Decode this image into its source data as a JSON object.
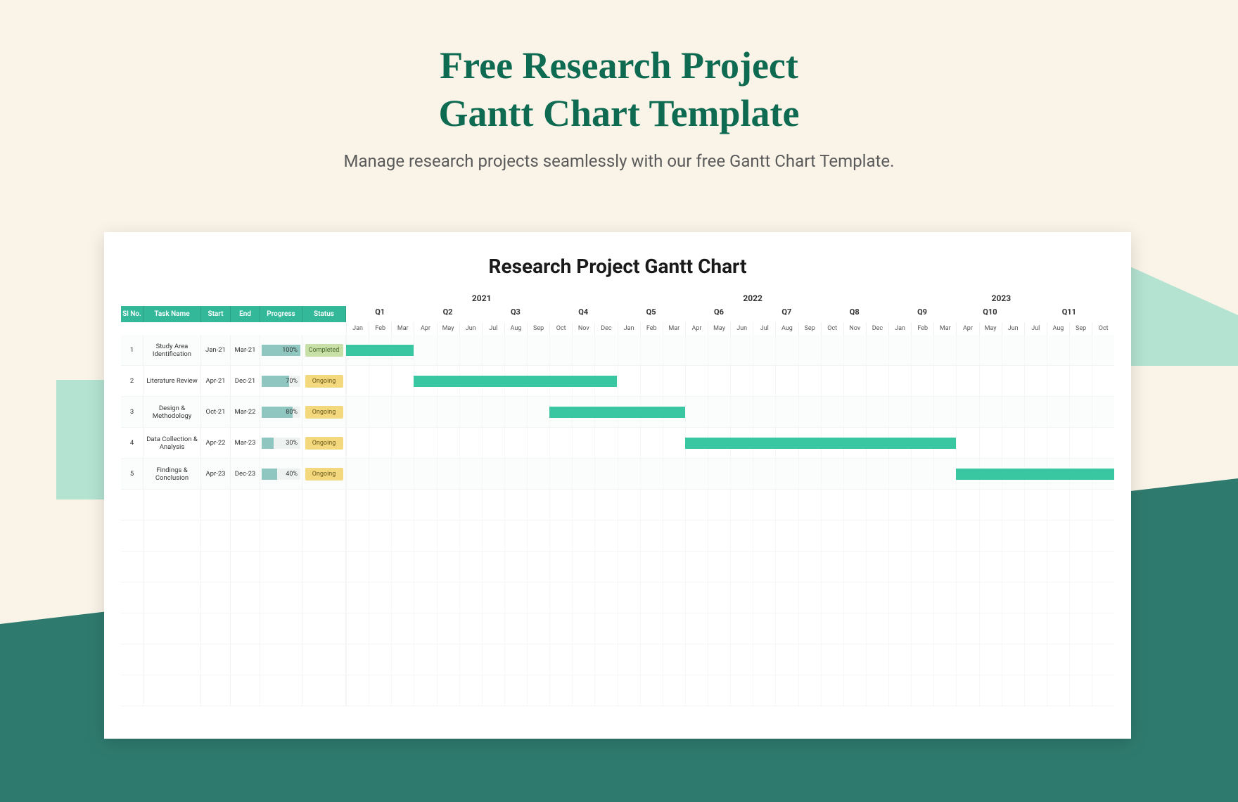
{
  "page": {
    "title_line1": "Free Research Project",
    "title_line2": "Gantt Chart Template",
    "subtitle": "Manage research projects seamlessly with our free Gantt Chart Template."
  },
  "chart_title": "Research Project Gantt Chart",
  "columns": {
    "sl": "Sl No.",
    "task": "Task Name",
    "start": "Start",
    "end": "End",
    "progress": "Progress",
    "status": "Status"
  },
  "years": [
    "2021",
    "2022",
    "2023"
  ],
  "quarters": [
    "Q1",
    "Q2",
    "Q3",
    "Q4",
    "Q5",
    "Q6",
    "Q7",
    "Q8",
    "Q9",
    "Q10",
    "Q11"
  ],
  "months": [
    "Jan",
    "Feb",
    "Mar",
    "Apr",
    "May",
    "Jun",
    "Jul",
    "Aug",
    "Sep",
    "Oct",
    "Nov",
    "Dec",
    "Jan",
    "Feb",
    "Mar",
    "Apr",
    "May",
    "Jun",
    "Jul",
    "Aug",
    "Sep",
    "Oct",
    "Nov",
    "Dec",
    "Jan",
    "Feb",
    "Mar",
    "Apr",
    "May",
    "Jun",
    "Jul",
    "Aug",
    "Sep",
    "Oct"
  ],
  "tasks": [
    {
      "sl": "1",
      "name": "Study Area Identification",
      "start": "Jan-21",
      "end": "Mar-21",
      "progress": 100,
      "progress_label": "100%",
      "status": "Completed",
      "bar_start": 0,
      "bar_span": 3
    },
    {
      "sl": "2",
      "name": "Literature Review",
      "start": "Apr-21",
      "end": "Dec-21",
      "progress": 70,
      "progress_label": "70%",
      "status": "Ongoing",
      "bar_start": 3,
      "bar_span": 9
    },
    {
      "sl": "3",
      "name": "Design & Methodology",
      "start": "Oct-21",
      "end": "Mar-22",
      "progress": 80,
      "progress_label": "80%",
      "status": "Ongoing",
      "bar_start": 9,
      "bar_span": 6
    },
    {
      "sl": "4",
      "name": "Data Collection & Analysis",
      "start": "Apr-22",
      "end": "Mar-23",
      "progress": 30,
      "progress_label": "30%",
      "status": "Ongoing",
      "bar_start": 15,
      "bar_span": 12
    },
    {
      "sl": "5",
      "name": "Findings & Conclusion",
      "start": "Apr-23",
      "end": "Dec-23",
      "progress": 40,
      "progress_label": "40%",
      "status": "Ongoing",
      "bar_start": 27,
      "bar_span": 7
    }
  ],
  "chart_data": {
    "type": "gantt",
    "title": "Research Project Gantt Chart",
    "x_axis": {
      "unit": "month",
      "start": "2021-01",
      "end": "2023-10",
      "total_months": 34,
      "years": [
        {
          "label": "2021",
          "months": 12
        },
        {
          "label": "2022",
          "months": 12
        },
        {
          "label": "2023",
          "months": 10
        }
      ],
      "quarter_labels": [
        "Q1",
        "Q2",
        "Q3",
        "Q4",
        "Q5",
        "Q6",
        "Q7",
        "Q8",
        "Q9",
        "Q10",
        "Q11"
      ]
    },
    "series": [
      {
        "id": 1,
        "name": "Study Area Identification",
        "start": "2021-01",
        "end": "2021-03",
        "progress_pct": 100,
        "status": "Completed"
      },
      {
        "id": 2,
        "name": "Literature Review",
        "start": "2021-04",
        "end": "2021-12",
        "progress_pct": 70,
        "status": "Ongoing"
      },
      {
        "id": 3,
        "name": "Design & Methodology",
        "start": "2021-10",
        "end": "2022-03",
        "progress_pct": 80,
        "status": "Ongoing"
      },
      {
        "id": 4,
        "name": "Data Collection & Analysis",
        "start": "2022-04",
        "end": "2023-03",
        "progress_pct": 30,
        "status": "Ongoing"
      },
      {
        "id": 5,
        "name": "Findings & Conclusion",
        "start": "2023-04",
        "end": "2023-12",
        "progress_pct": 40,
        "status": "Ongoing"
      }
    ]
  }
}
